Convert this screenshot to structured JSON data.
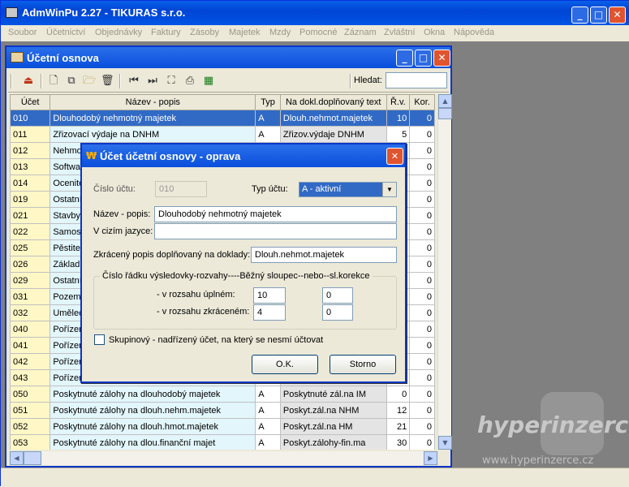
{
  "app": {
    "title": "AdmWinPu 2.27 - TIKURAS  s.r.o."
  },
  "menu": [
    "Soubor",
    "Účetnictví",
    "Objednávky",
    "Faktury",
    "Zásoby",
    "Majetek",
    "Mzdy",
    "Pomocné",
    "Záznam",
    "Zvláštní",
    "Okna",
    "Nápověda"
  ],
  "child": {
    "title": "Účetní osnova",
    "search_label": "Hledat:"
  },
  "grid": {
    "headers": [
      "Účet",
      "Název - popis",
      "Typ",
      "Na dokl.doplňovaný text",
      "Ř.v.",
      "Kor."
    ],
    "rows": [
      [
        "010",
        "Dlouhodobý nehmotný majetek",
        "A",
        "Dlouh.nehmot.majetek",
        "10",
        "0"
      ],
      [
        "011",
        "Zřizovací výdaje na DNHM",
        "A",
        "Zřizov.výdaje DNHM",
        "5",
        "0"
      ],
      [
        "012",
        "Nehmot",
        "",
        "",
        "",
        "0"
      ],
      [
        "013",
        "Softwar",
        "",
        "",
        "",
        "0"
      ],
      [
        "014",
        "Ocenite",
        "",
        "",
        "",
        "0"
      ],
      [
        "019",
        "Ostatní",
        "",
        "",
        "",
        "0"
      ],
      [
        "021",
        "Stavby",
        "",
        "",
        "",
        "0"
      ],
      [
        "022",
        "Samost",
        "",
        "",
        "",
        "0"
      ],
      [
        "025",
        "Pěstitel",
        "",
        "",
        "",
        "0"
      ],
      [
        "026",
        "Základ",
        "",
        "",
        "",
        "0"
      ],
      [
        "029",
        "Ostatní",
        "",
        "",
        "",
        "0"
      ],
      [
        "031",
        "Pozemk",
        "",
        "",
        "",
        "0"
      ],
      [
        "032",
        "Uměleo",
        "",
        "",
        "",
        "0"
      ],
      [
        "040",
        "Pořízen",
        "",
        "",
        "",
        "0"
      ],
      [
        "041",
        "Pořízen",
        "",
        "",
        "",
        "0"
      ],
      [
        "042",
        "Pořízen",
        "",
        "",
        "",
        "0"
      ],
      [
        "043",
        "Pořízen",
        "",
        "",
        "",
        "0"
      ],
      [
        "050",
        "Poskytnuté zálohy na dlouhodobý majetek",
        "A",
        "Poskytnuté zál.na IM",
        "0",
        "0"
      ],
      [
        "051",
        "Poskytnuté zálohy na dlouh.nehm.majetek",
        "A",
        "Poskyt.zál.na NHM",
        "12",
        "0"
      ],
      [
        "052",
        "Poskytnuté zálohy na dlouh.hmot.majetek",
        "A",
        "Poskyt.zál.na HM",
        "21",
        "0"
      ],
      [
        "053",
        "Poskytnuté zálohy na dlou.finanční majet",
        "A",
        "Poskyt.zálohy-fin.ma",
        "30",
        "0"
      ]
    ]
  },
  "dialog": {
    "title": "Účet účetní osnovy - oprava",
    "cislo_label": "Číslo účtu:",
    "cislo_value": "010",
    "typ_label": "Typ účtu:",
    "typ_value": "A - aktivní",
    "nazev_label": "Název - popis:",
    "nazev_value": "Dlouhodobý nehmotný majetek",
    "cizi_label": "V cizím jazyce:",
    "cizi_value": "",
    "zkraceny_label": "Zkrácený popis doplňovaný na doklady:",
    "zkraceny_value": "Dlouh.nehmot.majetek",
    "group_title": "Číslo řádku výsledovky-rozvahy----Běžný sloupec--nebo--sl.korekce",
    "uplny_label": "- v rozsahu úplném:",
    "uplny_1": "10",
    "uplny_2": "0",
    "zkraceny_rozsah_label": "- v rozsahu zkráceném:",
    "zkraceny_1": "4",
    "zkraceny_2": "0",
    "skupinovy_label": "Skupinový - nadřízený účet, na který se nesmí účtovat",
    "ok_label": "O.K.",
    "storno_label": "Storno"
  },
  "watermark": {
    "brand": "hyperinzerce",
    "url": "www.hyperinzerce.cz"
  }
}
